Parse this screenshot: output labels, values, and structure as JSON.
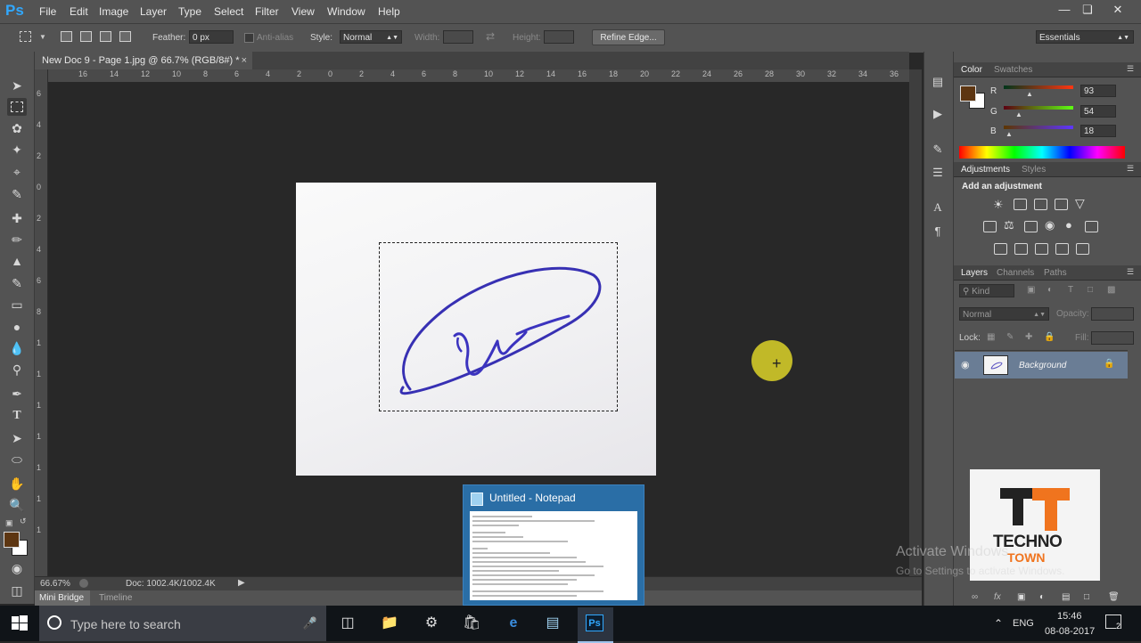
{
  "menubar": {
    "logo": "Ps",
    "items": [
      "File",
      "Edit",
      "Image",
      "Layer",
      "Type",
      "Select",
      "Filter",
      "View",
      "Window",
      "Help"
    ]
  },
  "options": {
    "feather_label": "Feather:",
    "feather_value": "0 px",
    "antialias_label": "Anti-alias",
    "style_label": "Style:",
    "style_value": "Normal",
    "width_label": "Width:",
    "height_label": "Height:",
    "refine_edge": "Refine Edge...",
    "workspace": "Essentials"
  },
  "document": {
    "tab_title": "New Doc 9 - Page 1.jpg @ 66.7% (RGB/8#) *",
    "ruler_top": [
      "16",
      "14",
      "12",
      "10",
      "8",
      "6",
      "4",
      "2",
      "0",
      "2",
      "4",
      "6",
      "8",
      "10",
      "12",
      "14",
      "16",
      "18",
      "20",
      "22",
      "24",
      "26",
      "28",
      "30",
      "32",
      "34",
      "36"
    ],
    "ruler_left": [
      "6",
      "4",
      "2",
      "0",
      "2",
      "4",
      "6",
      "8",
      "1",
      "1",
      "1",
      "1",
      "1",
      "1",
      "1"
    ]
  },
  "status": {
    "zoom": "66.67%",
    "doc_size": "Doc: 1002.4K/1002.4K",
    "mini_bridge": "Mini Bridge",
    "timeline": "Timeline"
  },
  "color_panel": {
    "tabs": [
      "Color",
      "Swatches"
    ],
    "channels": [
      {
        "label": "R",
        "value": "93"
      },
      {
        "label": "G",
        "value": "54"
      },
      {
        "label": "B",
        "value": "18"
      }
    ],
    "foreground": "#5d3612",
    "background": "#ffffff"
  },
  "adjustments_panel": {
    "tabs": [
      "Adjustments",
      "Styles"
    ],
    "heading": "Add an adjustment"
  },
  "layers_panel": {
    "tabs": [
      "Layers",
      "Channels",
      "Paths"
    ],
    "kind_filter": "Kind",
    "blend_mode": "Normal",
    "opacity_label": "Opacity:",
    "lock_label": "Lock:",
    "fill_label": "Fill:",
    "layer_name": "Background"
  },
  "logo": {
    "line1": "TECHNO",
    "line2": "TOWN"
  },
  "notepad_popup": {
    "title": "Untitled - Notepad"
  },
  "watermark": {
    "line1": "Activate Windows",
    "line2": "Go to Settings to activate Windows."
  },
  "taskbar": {
    "search_placeholder": "Type here to search",
    "language": "ENG",
    "time": "15:46",
    "date": "08-08-2017",
    "notifications": "2"
  }
}
